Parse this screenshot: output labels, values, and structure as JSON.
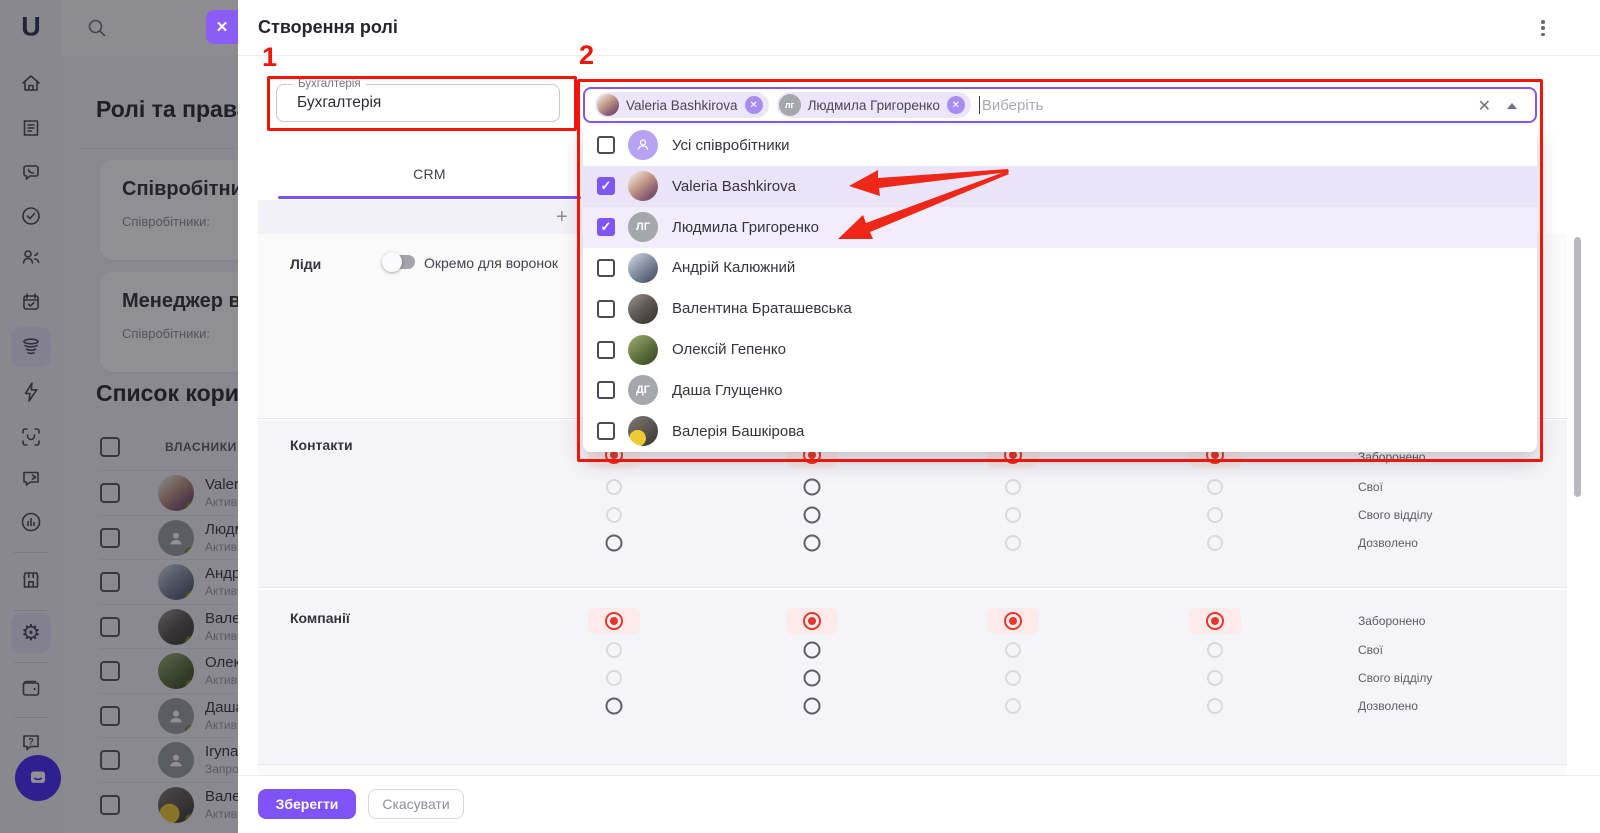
{
  "colors": {
    "accent_purple": "#7E57F2",
    "annotation_red": "#F2150A",
    "radio_red": "#E5382C",
    "save_button": "#8053F6",
    "selected_row": "#EBE4F9"
  },
  "annotations": {
    "step1": "1",
    "step2": "2"
  },
  "sidebar": {
    "logo": "U",
    "icons": [
      "home",
      "organization",
      "calls",
      "tasks",
      "people",
      "calendar",
      "crm-funnel",
      "automations",
      "face-id",
      "marketing",
      "analytics",
      "marketplace",
      "settings",
      "wallet",
      "help"
    ],
    "messenger": "support-chat",
    "settings_glyph": "⚙"
  },
  "background": {
    "page_title": "Ролі та права",
    "cards": [
      {
        "title": "Співробітник",
        "subtitle": "Співробітники:"
      },
      {
        "title": "Менеджер відд",
        "subtitle": "Співробітники:"
      }
    ],
    "list_title": "Список корис",
    "table_header": "ВЛАСНИКИ РО",
    "users": [
      {
        "name": "Valeri",
        "status": "Активн"
      },
      {
        "name": "Людм",
        "status": "Активн"
      },
      {
        "name": "Андрі",
        "status": "Активн"
      },
      {
        "name": "Вален",
        "status": "Активн"
      },
      {
        "name": "Олекс",
        "status": "Активн"
      },
      {
        "name": "Даша",
        "status": "Активн"
      },
      {
        "name": "Iryna",
        "status": "Запрош"
      },
      {
        "name": "Валер",
        "status": "Активн"
      }
    ]
  },
  "modal": {
    "title": "Створення ролі",
    "close_label": "✕",
    "name_field": {
      "label": "Бухгалтерія",
      "value": "Бухгалтерія"
    },
    "members_select": {
      "chips": [
        {
          "label": "Valeria Bashkirova",
          "remove": "✕"
        },
        {
          "label": "Людмила Григоренко",
          "initials": "лг",
          "remove": "✕"
        }
      ],
      "placeholder": "Виберіть",
      "clear": "✕"
    },
    "dropdown": {
      "options": [
        {
          "label": "Усі співробітники",
          "checked": false
        },
        {
          "label": "Valeria Bashkirova",
          "checked": true
        },
        {
          "label": "Людмила Григоренко",
          "checked": true,
          "initials": "ЛГ"
        },
        {
          "label": "Андрій Калюжний",
          "checked": false
        },
        {
          "label": "Валентина Браташевська",
          "checked": false
        },
        {
          "label": "Олексій Гепенко",
          "checked": false
        },
        {
          "label": "Даша Глущенко",
          "checked": false,
          "initials": "ДГ"
        },
        {
          "label": "Валерія Башкірова",
          "checked": false
        }
      ],
      "check_glyph": "✓"
    },
    "tabs": [
      {
        "label": "CRM",
        "active": true
      }
    ],
    "add_tab_label": "+",
    "sections": {
      "leads": {
        "label": "Ліди",
        "toggle_label": "Окремо для воронок",
        "toggle_on": false
      },
      "contacts": {
        "label": "Контакти"
      },
      "companies": {
        "label": "Компанії"
      }
    },
    "permission_labels": [
      "Заборонено",
      "Свої",
      "Свого відділу",
      "Дозволено"
    ],
    "footer": {
      "save": "Зберегти",
      "cancel": "Скасувати"
    }
  }
}
